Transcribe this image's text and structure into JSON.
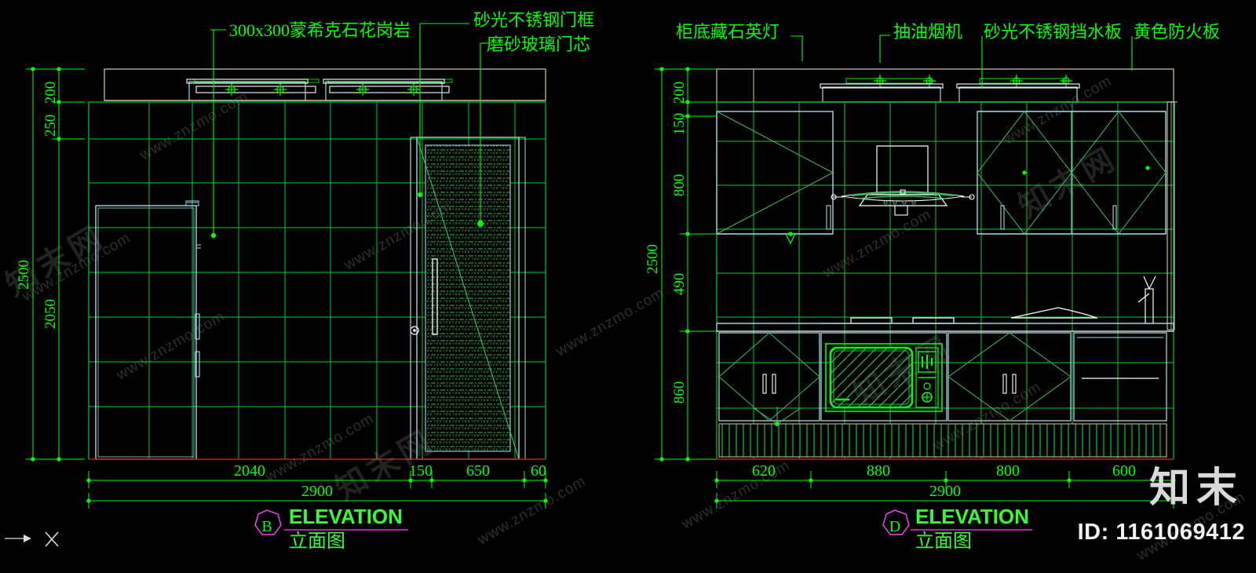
{
  "drawing": {
    "type": "AutoCAD kitchen interior elevation drawing",
    "background": "#000000",
    "colors": {
      "dimension_green": "#00ff00",
      "wall_tile_green": "#00cc33",
      "cabinet_cyan": "#9fd8e0",
      "furniture_white": "#ffffff",
      "ceiling_tan": "#d8c9a0",
      "floor_red": "#a02020",
      "title_magenta": "#ff44ff",
      "watermark_grey": "#9a9a9a"
    },
    "axis_marker": "X"
  },
  "left_elevation": {
    "id": "B",
    "title_en": "ELEVATION",
    "title_cn": "立面图",
    "annotations": [
      {
        "text": "300x300蒙希克石花岗岩",
        "target": "wall-tile"
      },
      {
        "text": "砂光不锈钢门框",
        "target": "door-frame"
      },
      {
        "text": "磨砂玻璃门芯",
        "target": "door-glass-panel"
      }
    ],
    "vertical_dims": {
      "chain": [
        "200",
        "250",
        "2050"
      ],
      "overall": "2500"
    },
    "horizontal_dims": {
      "chain": [
        "2040",
        "150",
        "650",
        "60"
      ],
      "overall": "2900"
    },
    "elements": [
      "ceiling-soffit",
      "ceiling-light-fixture-1",
      "ceiling-light-fixture-2",
      "tall-refrigerator-unit",
      "frosted-glass-door",
      "granite-tiled-wall"
    ]
  },
  "right_elevation": {
    "id": "D",
    "title_en": "ELEVATION",
    "title_cn": "立面图",
    "annotations": [
      {
        "text": "柜底藏石英灯",
        "target": "under-cabinet-light"
      },
      {
        "text": "抽油烟机",
        "target": "range-hood"
      },
      {
        "text": "砂光不锈钢挡水板",
        "target": "stainless-backsplash"
      },
      {
        "text": "黄色防火板",
        "target": "yellow-fireproof-board"
      }
    ],
    "vertical_dims": {
      "chain": [
        "200",
        "150",
        "800",
        "490",
        "860"
      ],
      "overall": "2500"
    },
    "horizontal_dims": {
      "chain": [
        "620",
        "880",
        "800",
        "600"
      ],
      "overall": "2900"
    },
    "elements": [
      "ceiling-soffit",
      "ceiling-light-fixture-1",
      "ceiling-light-fixture-2",
      "wall-cabinet-left",
      "wall-cabinet-right",
      "range-hood",
      "gas-cooktop",
      "countertop",
      "sink-faucet",
      "base-cabinet-left",
      "built-in-microwave",
      "base-cabinet-right",
      "open-shelf-unit",
      "toe-kick-hatch"
    ]
  },
  "watermarks": {
    "site_url": "www.znzmo.com",
    "site_cn": "知末网",
    "logo_cn": "知末",
    "id_label": "ID: 1161069412"
  }
}
